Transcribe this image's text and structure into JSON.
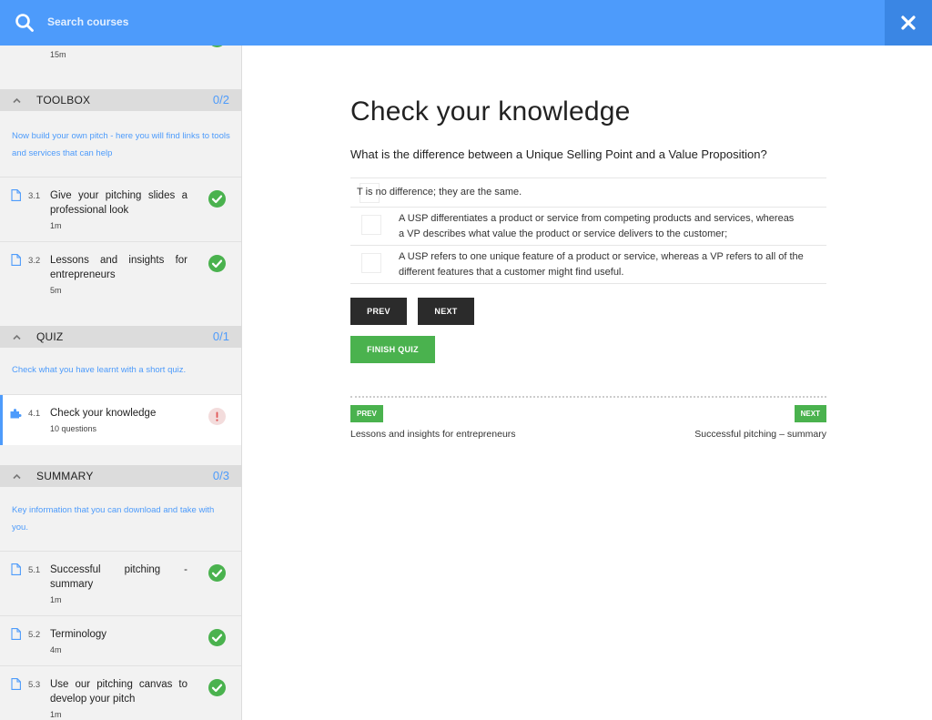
{
  "search": {
    "placeholder": "Search courses"
  },
  "sidebar": {
    "top_item": {
      "meta": "15m"
    },
    "sections": [
      {
        "title": "TOOLBOX",
        "count": "0/2",
        "description": "Now build your own pitch - here you will find links to tools and services that can help",
        "items": [
          {
            "num": "3.1",
            "title": "Give your pitching slides a professional look",
            "meta": "1m",
            "status": "complete"
          },
          {
            "num": "3.2",
            "title": "Lessons and insights for entrepreneurs",
            "meta": "5m",
            "status": "complete"
          }
        ]
      },
      {
        "title": "QUIZ",
        "count": "0/1",
        "description": "Check what you have learnt with a short quiz.",
        "items": [
          {
            "num": "4.1",
            "title": "Check your knowledge",
            "meta": "10 questions",
            "status": "alert"
          }
        ]
      },
      {
        "title": "SUMMARY",
        "count": "0/3",
        "description": "Key information that you can download and take with you.",
        "items": [
          {
            "num": "5.1",
            "title": "Successful pitching - summary",
            "meta": "1m",
            "status": "complete"
          },
          {
            "num": "5.2",
            "title": "Terminology",
            "meta": "4m",
            "status": "complete"
          },
          {
            "num": "5.3",
            "title": "Use our pitching canvas to develop your pitch",
            "meta": "1m",
            "status": "complete"
          }
        ]
      }
    ]
  },
  "main": {
    "title": "Check your knowledge",
    "question": "What is the difference between a Unique Selling Point and a Value Proposition?",
    "answers": [
      {
        "text": "T is no difference; they are the same."
      },
      {
        "text": "A USP differentiates a product or service from competing products and services, whereas a VP describes what value the product or service delivers to the customer;"
      },
      {
        "text": "A USP refers to one unique feature of a product or service, whereas a VP refers to all of the different features that a customer might find useful."
      }
    ],
    "prev_label": "PREV",
    "next_label": "NEXT",
    "finish_label": "FINISH QUIZ"
  },
  "pager": {
    "prev_label": "PREV",
    "next_label": "NEXT",
    "prev_title": "Lessons and insights for entrepreneurs",
    "next_title": "Successful pitching – summary"
  },
  "colors": {
    "accent": "#4d9bfb",
    "success": "#4ab24e",
    "dark": "#2b2b2b",
    "alert": "#e05555"
  }
}
